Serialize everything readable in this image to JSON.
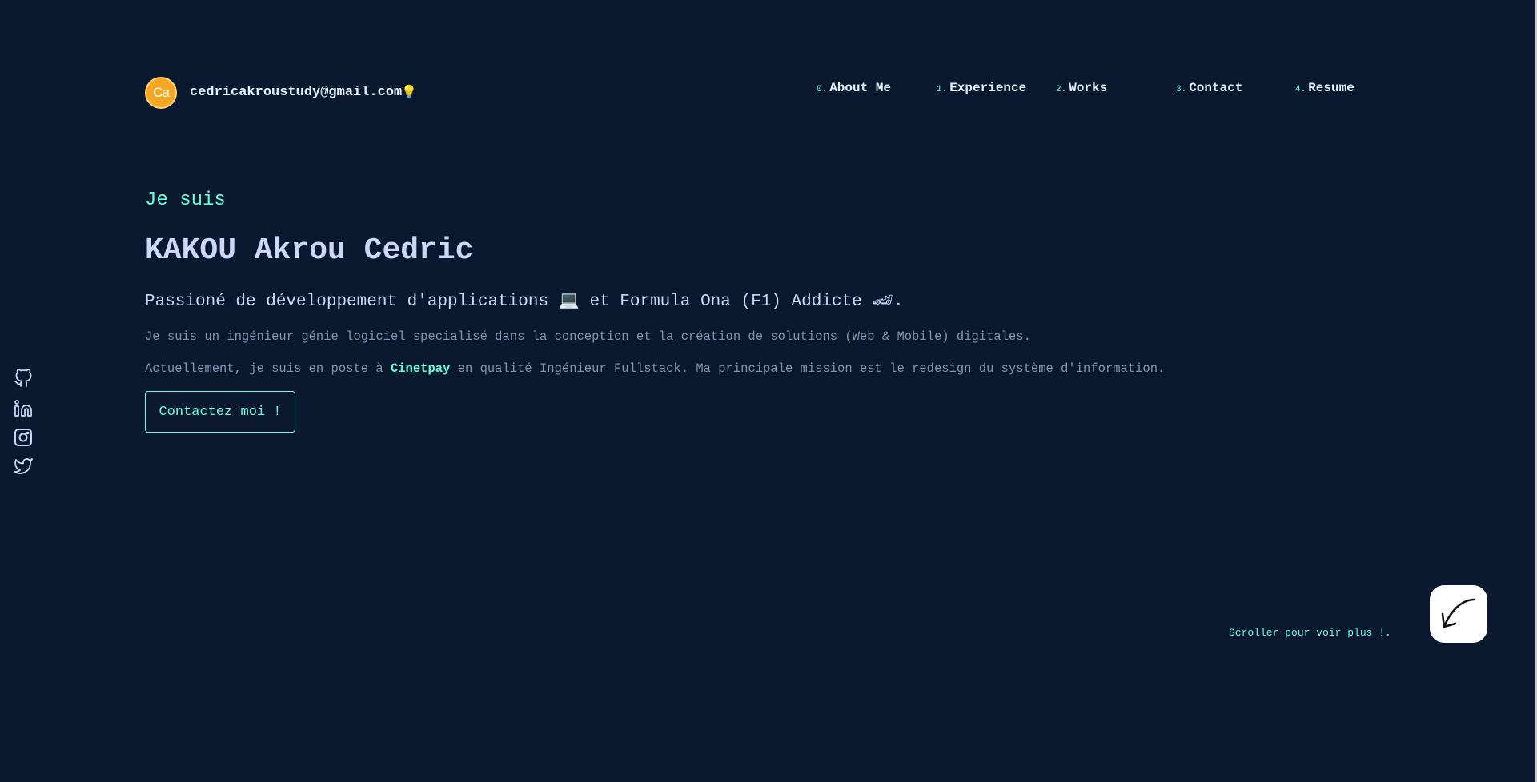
{
  "header": {
    "logo_text": "Ca",
    "email": "cedricakroustudy@gmail.com",
    "bulb_icon": "💡"
  },
  "nav": {
    "items": [
      {
        "num": "0.",
        "label": "About Me"
      },
      {
        "num": "1.",
        "label": "Experience"
      },
      {
        "num": "2.",
        "label": "Works"
      },
      {
        "num": "3.",
        "label": "Contact"
      },
      {
        "num": "4.",
        "label": "Resume"
      }
    ]
  },
  "hero": {
    "greeting": "Je suis",
    "name": "KAKOU Akrou Cedric",
    "tagline_part1": "Passioné de développement d'applications",
    "laptop_emoji": "💻",
    "tagline_part2": " et Formula Ona (F1) Addicte",
    "car_emoji": "🏎",
    "tagline_end": ".",
    "description": "Je suis un ingénieur génie logiciel specialisé dans la conception et la création de solutions (Web & Mobile) digitales.",
    "current_prefix": "Actuellement, je suis en poste à ",
    "company": "Cinetpay",
    "current_suffix": " en qualité Ingénieur Fullstack. Ma principale mission est le redesign du système d'information.",
    "cta_label": "Contactez moi !"
  },
  "social": {
    "icons": [
      "github-icon",
      "linkedin-icon",
      "instagram-icon",
      "twitter-icon"
    ]
  },
  "scroll": {
    "hint": "Scroller pour voir plus !."
  },
  "colors": {
    "background": "#0a192f",
    "accent": "#64ffda",
    "heading": "#ccd6f6",
    "muted": "#8892b0",
    "logo": "#f5a623"
  }
}
